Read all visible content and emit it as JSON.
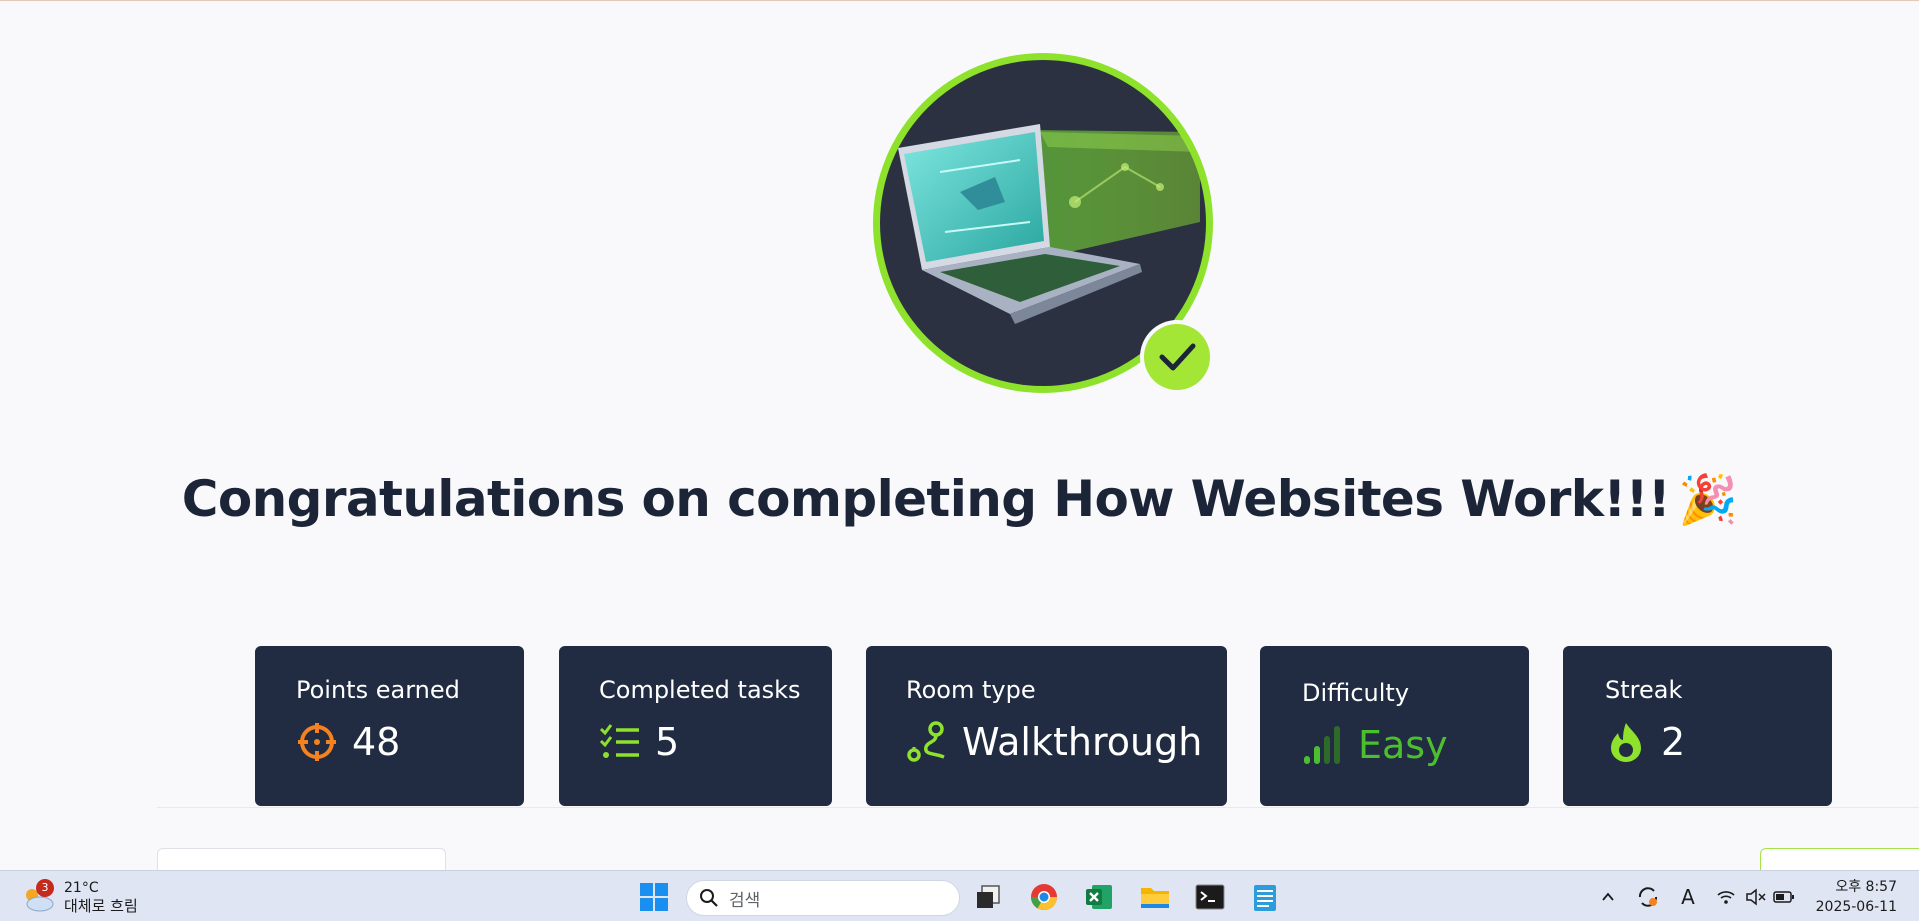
{
  "headline": {
    "text": "Congratulations on completing How Websites Work!!!",
    "emoji": "🎉"
  },
  "hero": {
    "icon": "laptop-illustration",
    "check_icon": "check-icon",
    "ring_color": "#8ee22c",
    "bg_color": "#2b3140"
  },
  "stats": [
    {
      "label": "Points earned",
      "value": "48",
      "icon": "target-icon",
      "icon_color": "#f5821f"
    },
    {
      "label": "Completed tasks",
      "value": "5",
      "icon": "checklist-icon",
      "icon_color": "#8ee22c"
    },
    {
      "label": "Room type",
      "value": "Walkthrough",
      "icon": "route-icon",
      "icon_color": "#8ee22c"
    },
    {
      "label": "Difficulty",
      "value": "Easy",
      "icon": "signal-bars-icon",
      "icon_color": "#4bbf2e"
    },
    {
      "label": "Streak",
      "value": "2",
      "icon": "flame-icon",
      "icon_color": "#8ee22c"
    }
  ],
  "taskbar": {
    "weather": {
      "badge": "3",
      "temp": "21°C",
      "condition": "대체로 흐림"
    },
    "search": {
      "placeholder": "검색"
    },
    "apps": [
      "windows-start-icon",
      "task-view-icon",
      "chrome-icon",
      "excel-icon",
      "file-explorer-icon",
      "terminal-icon",
      "notepad-icon"
    ],
    "tray": [
      "chevron-up-icon",
      "sync-icon",
      "ime-icon",
      "wifi-icon",
      "speaker-muted-icon",
      "battery-icon"
    ],
    "ime_label": "A",
    "clock": {
      "time": "오후 8:57",
      "date": "2025-06-11"
    }
  }
}
